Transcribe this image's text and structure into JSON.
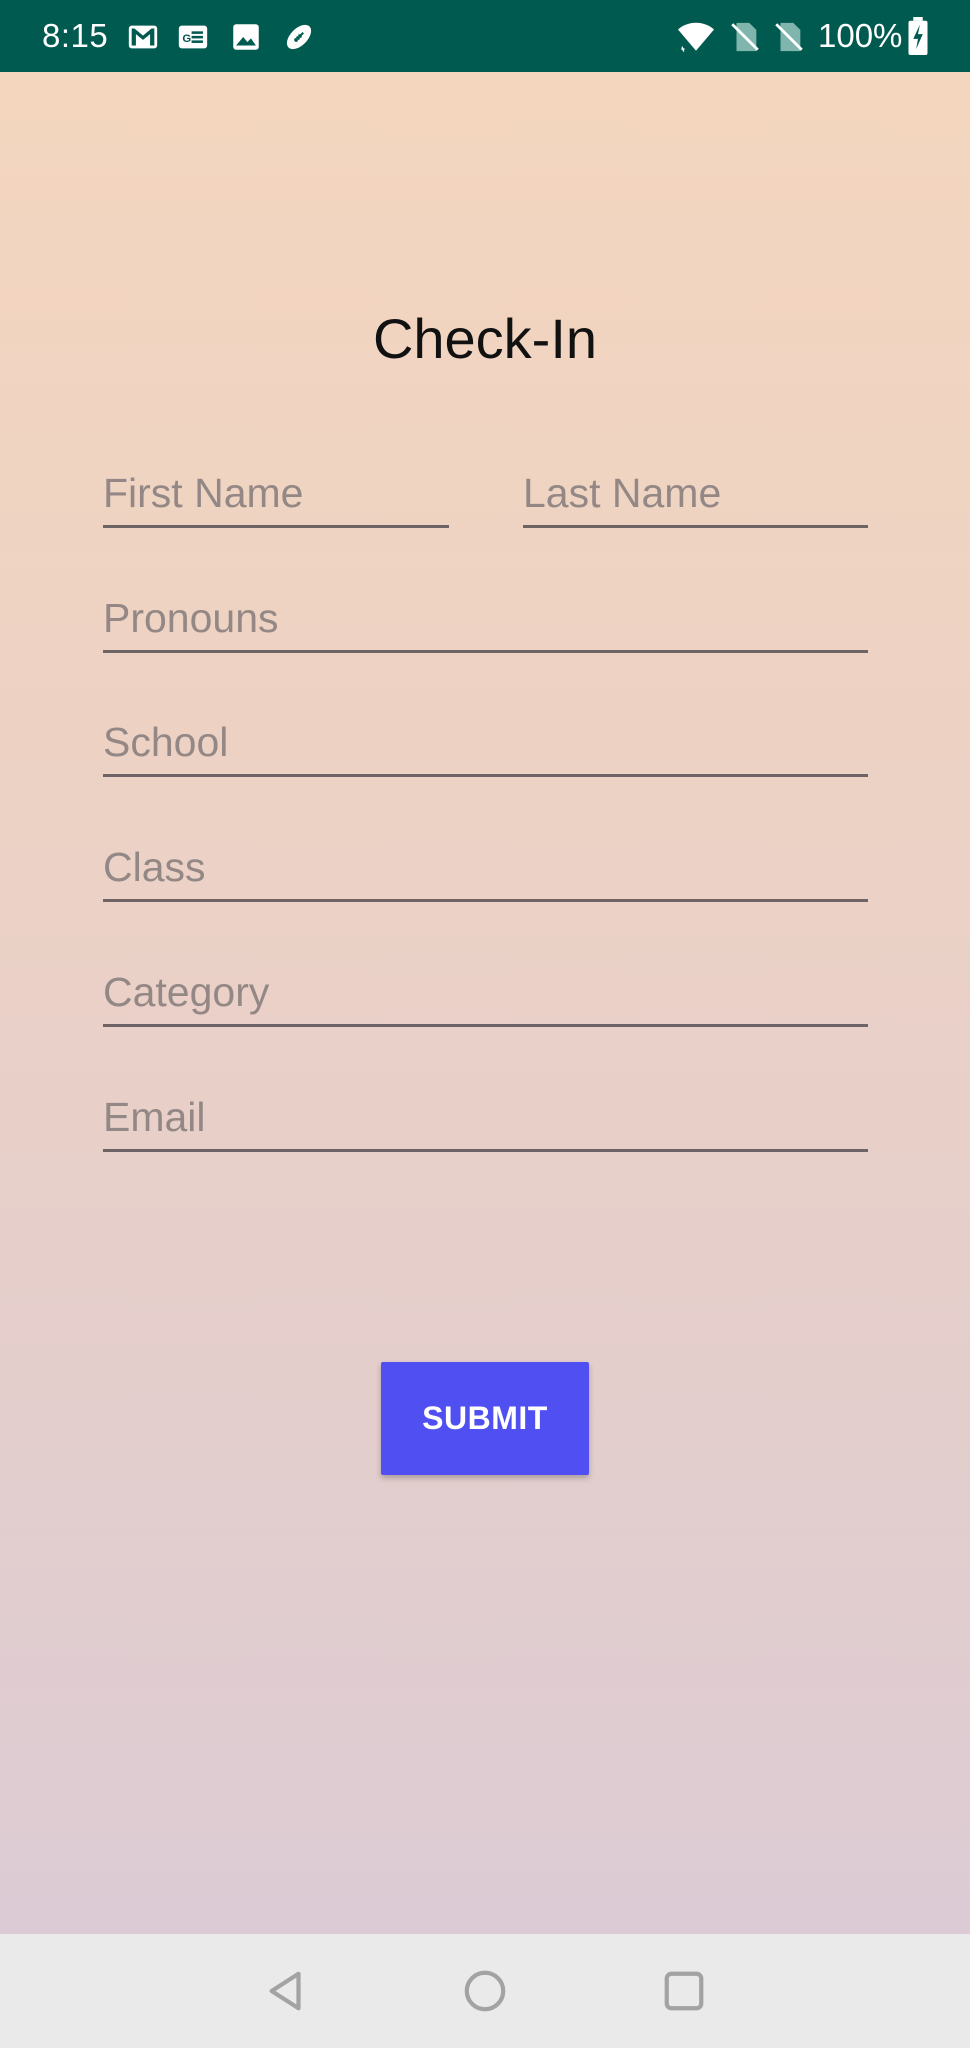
{
  "status_bar": {
    "time": "8:15",
    "battery": "100%",
    "background_color": "#005a4f",
    "left_icons": [
      "gmail-icon",
      "news-icon",
      "image-icon",
      "football-icon"
    ],
    "right_icons": [
      "wifi-icon",
      "no-sim-icon",
      "no-sim-icon",
      "battery-charging-icon"
    ]
  },
  "form": {
    "title": "Check-In",
    "fields": {
      "first_name": "First Name",
      "last_name": "Last Name",
      "pronouns": "Pronouns",
      "school": "School",
      "class": "Class",
      "category": "Category",
      "email": "Email"
    },
    "submit_label": "SUBMIT",
    "button_color": "#5050f2"
  },
  "nav_bar": {
    "icons": [
      "back-icon",
      "home-icon",
      "recents-icon"
    ]
  }
}
